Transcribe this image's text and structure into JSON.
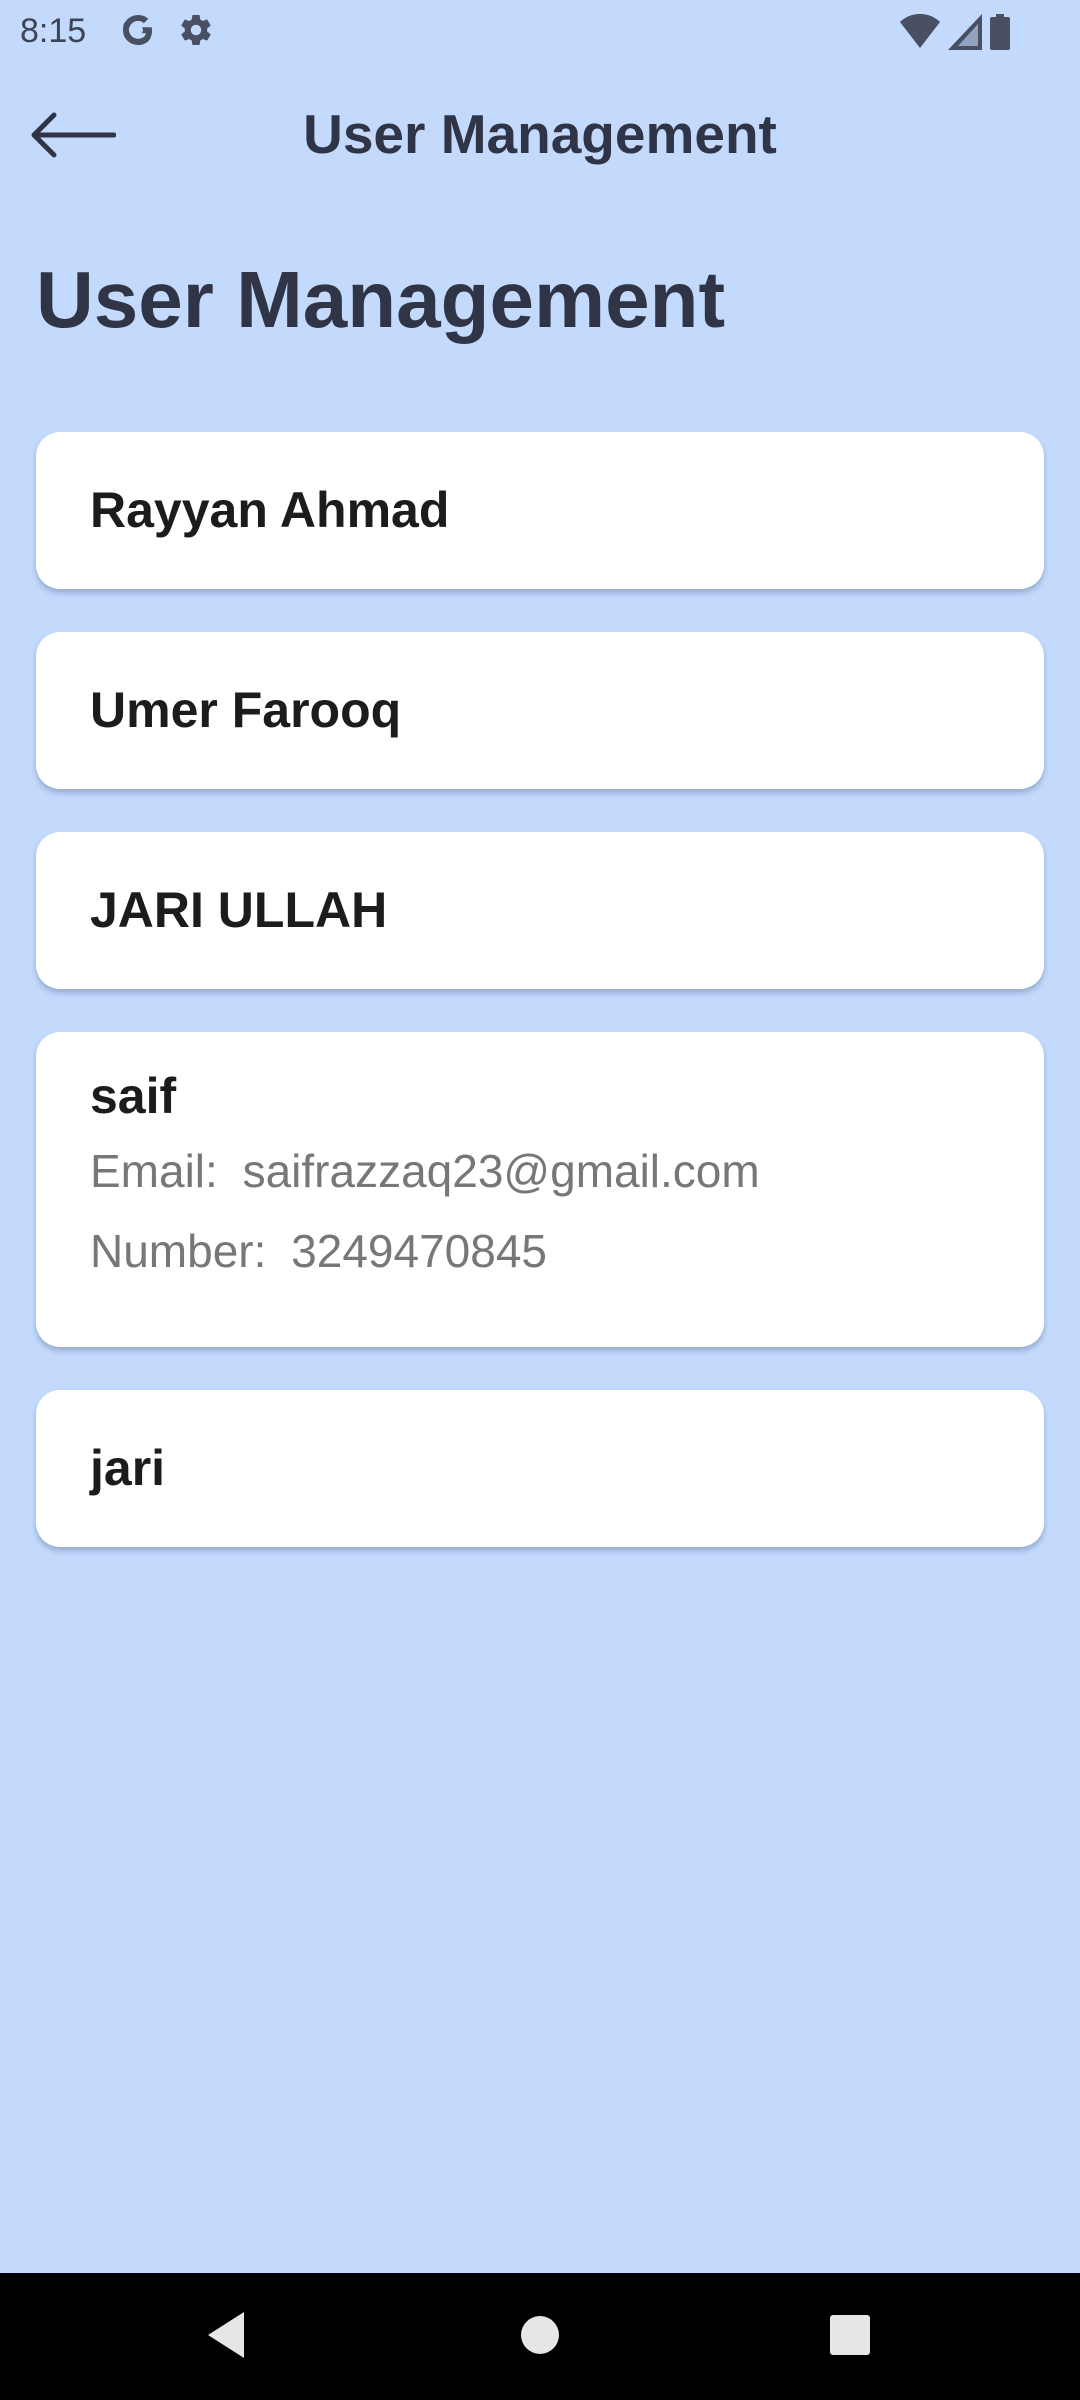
{
  "status_bar": {
    "time": "8:15",
    "icons": [
      "google-g-icon",
      "settings-gear-icon",
      "wifi-icon",
      "cellular-signal-icon",
      "battery-icon"
    ]
  },
  "app_bar": {
    "title": "User Management",
    "back_icon": "arrow-left-icon"
  },
  "page": {
    "heading": "User Management"
  },
  "users": [
    {
      "name": "Rayyan Ahmad"
    },
    {
      "name": "Umer Farooq"
    },
    {
      "name": "JARI ULLAH"
    },
    {
      "name": "saif",
      "email_label": "Email:",
      "email": "saifrazzaq23@gmail.com",
      "number_label": "Number:",
      "number": "3249470845"
    },
    {
      "name": "jari"
    }
  ],
  "nav_bar": {
    "buttons": [
      "back-triangle-icon",
      "home-circle-icon",
      "recents-square-icon"
    ]
  },
  "colors": {
    "background": "#c3dafd",
    "card": "#ffffff",
    "heading_text": "#2f3446",
    "detail_text": "#777777",
    "nav_bar": "#000000"
  }
}
